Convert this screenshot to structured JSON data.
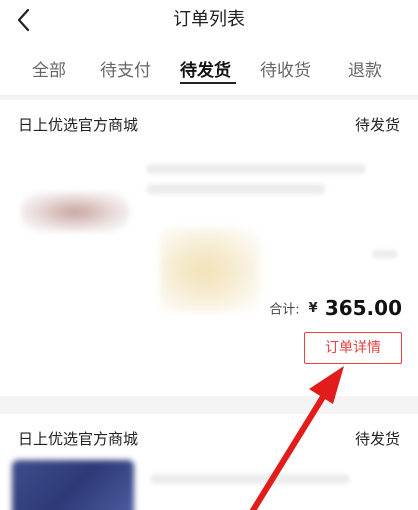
{
  "header": {
    "title": "订单列表"
  },
  "tabs": [
    {
      "label": "全部"
    },
    {
      "label": "待支付"
    },
    {
      "label": "待发货",
      "active": true
    },
    {
      "label": "待收货"
    },
    {
      "label": "退款"
    }
  ],
  "orders": [
    {
      "shop": "日上优选官方商城",
      "status": "待发货",
      "total_label": "合计:",
      "currency": "¥",
      "amount": "365.00",
      "detail_button": "订单详情"
    },
    {
      "shop": "日上优选官方商城",
      "status": "待发货"
    }
  ],
  "colors": {
    "accent": "#e84141",
    "arrow": "#e21b1b"
  }
}
